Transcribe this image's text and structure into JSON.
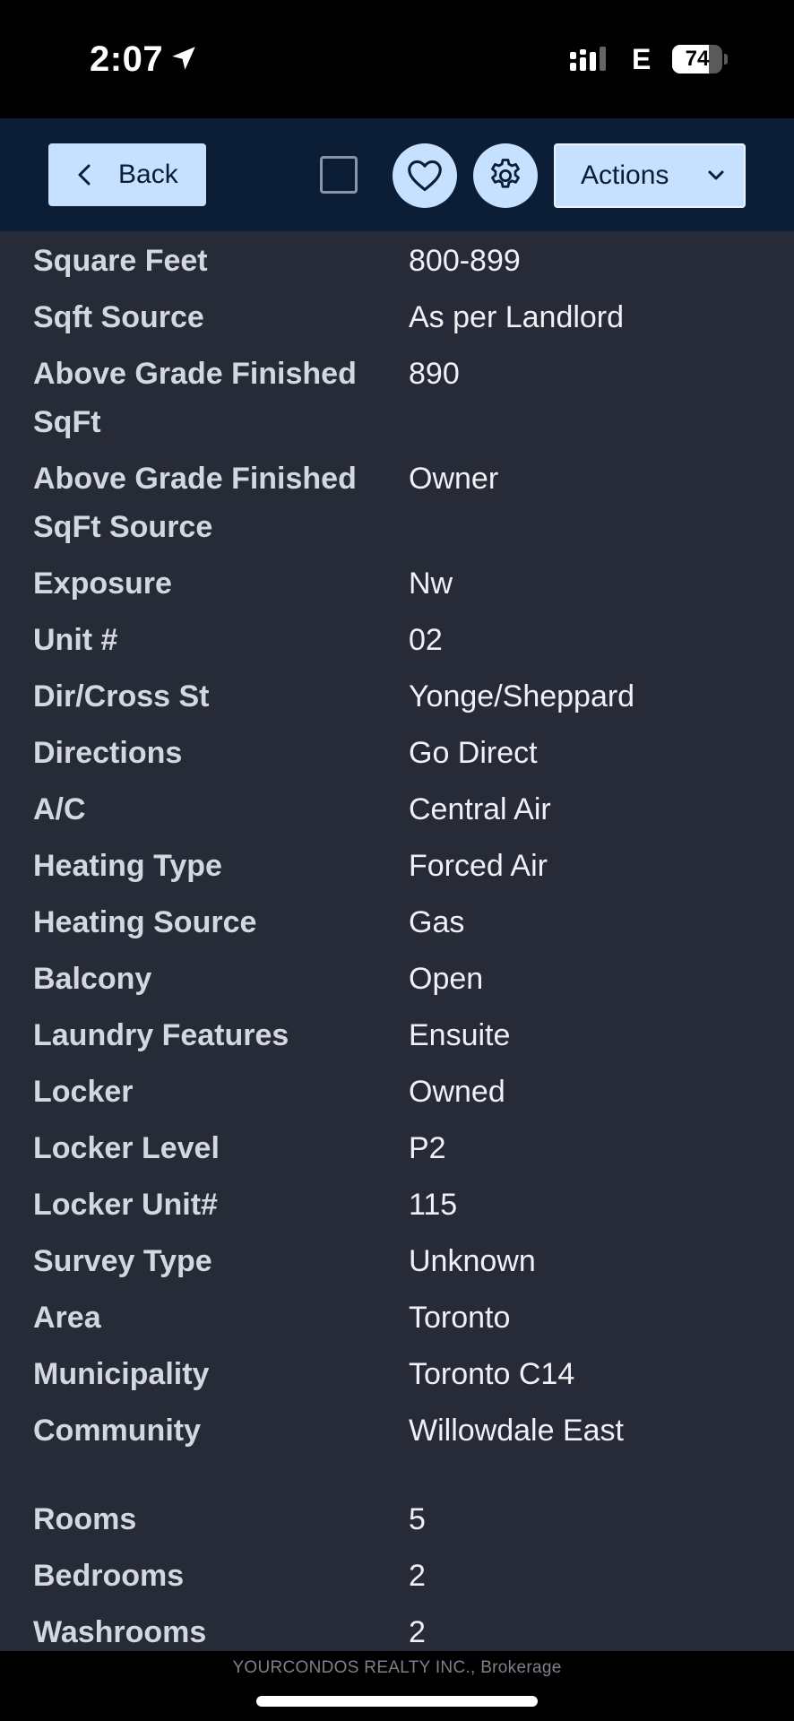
{
  "status_bar": {
    "time": "2:07",
    "network": "E",
    "battery_level": "74",
    "battery_fraction": 0.74
  },
  "toolbar": {
    "back_label": "Back",
    "actions_label": "Actions",
    "icons": {
      "back": "chevron-left-icon",
      "checkbox": "checkbox-icon",
      "favorite": "heart-icon",
      "settings": "gear-icon",
      "actions": "chevron-down-icon"
    }
  },
  "details": {
    "rows": [
      {
        "label": "Square Feet",
        "value": "800-899"
      },
      {
        "label": "Sqft Source",
        "value": "As per Landlord"
      },
      {
        "label": "Above Grade Finished SqFt",
        "value": "890"
      },
      {
        "label": "Above Grade Finished SqFt Source",
        "value": "Owner"
      },
      {
        "label": "Exposure",
        "value": "Nw"
      },
      {
        "label": "Unit #",
        "value": "02"
      },
      {
        "label": "Dir/Cross St",
        "value": "Yonge/Sheppard"
      },
      {
        "label": "Directions",
        "value": "Go Direct"
      },
      {
        "label": "A/C",
        "value": "Central Air"
      },
      {
        "label": "Heating Type",
        "value": "Forced Air"
      },
      {
        "label": "Heating Source",
        "value": "Gas"
      },
      {
        "label": "Balcony",
        "value": "Open"
      },
      {
        "label": "Laundry Features",
        "value": "Ensuite"
      },
      {
        "label": "Locker",
        "value": "Owned"
      },
      {
        "label": "Locker Level",
        "value": "P2"
      },
      {
        "label": "Locker Unit#",
        "value": "115"
      },
      {
        "label": "Survey Type",
        "value": "Unknown"
      },
      {
        "label": "Area",
        "value": "Toronto"
      },
      {
        "label": "Municipality",
        "value": "Toronto C14"
      },
      {
        "label": "Community",
        "value": "Willowdale East"
      },
      {
        "label": "Rooms",
        "value": "5"
      },
      {
        "label": "Bedrooms",
        "value": "2"
      },
      {
        "label": "Washrooms",
        "value": "2"
      }
    ]
  },
  "footer": {
    "brokerage": "YOURCONDOS REALTY INC., Brokerage"
  },
  "colors": {
    "toolbar_bg": "#0c1d36",
    "button_bg": "#c6e1ff",
    "content_bg": "#272b37"
  }
}
